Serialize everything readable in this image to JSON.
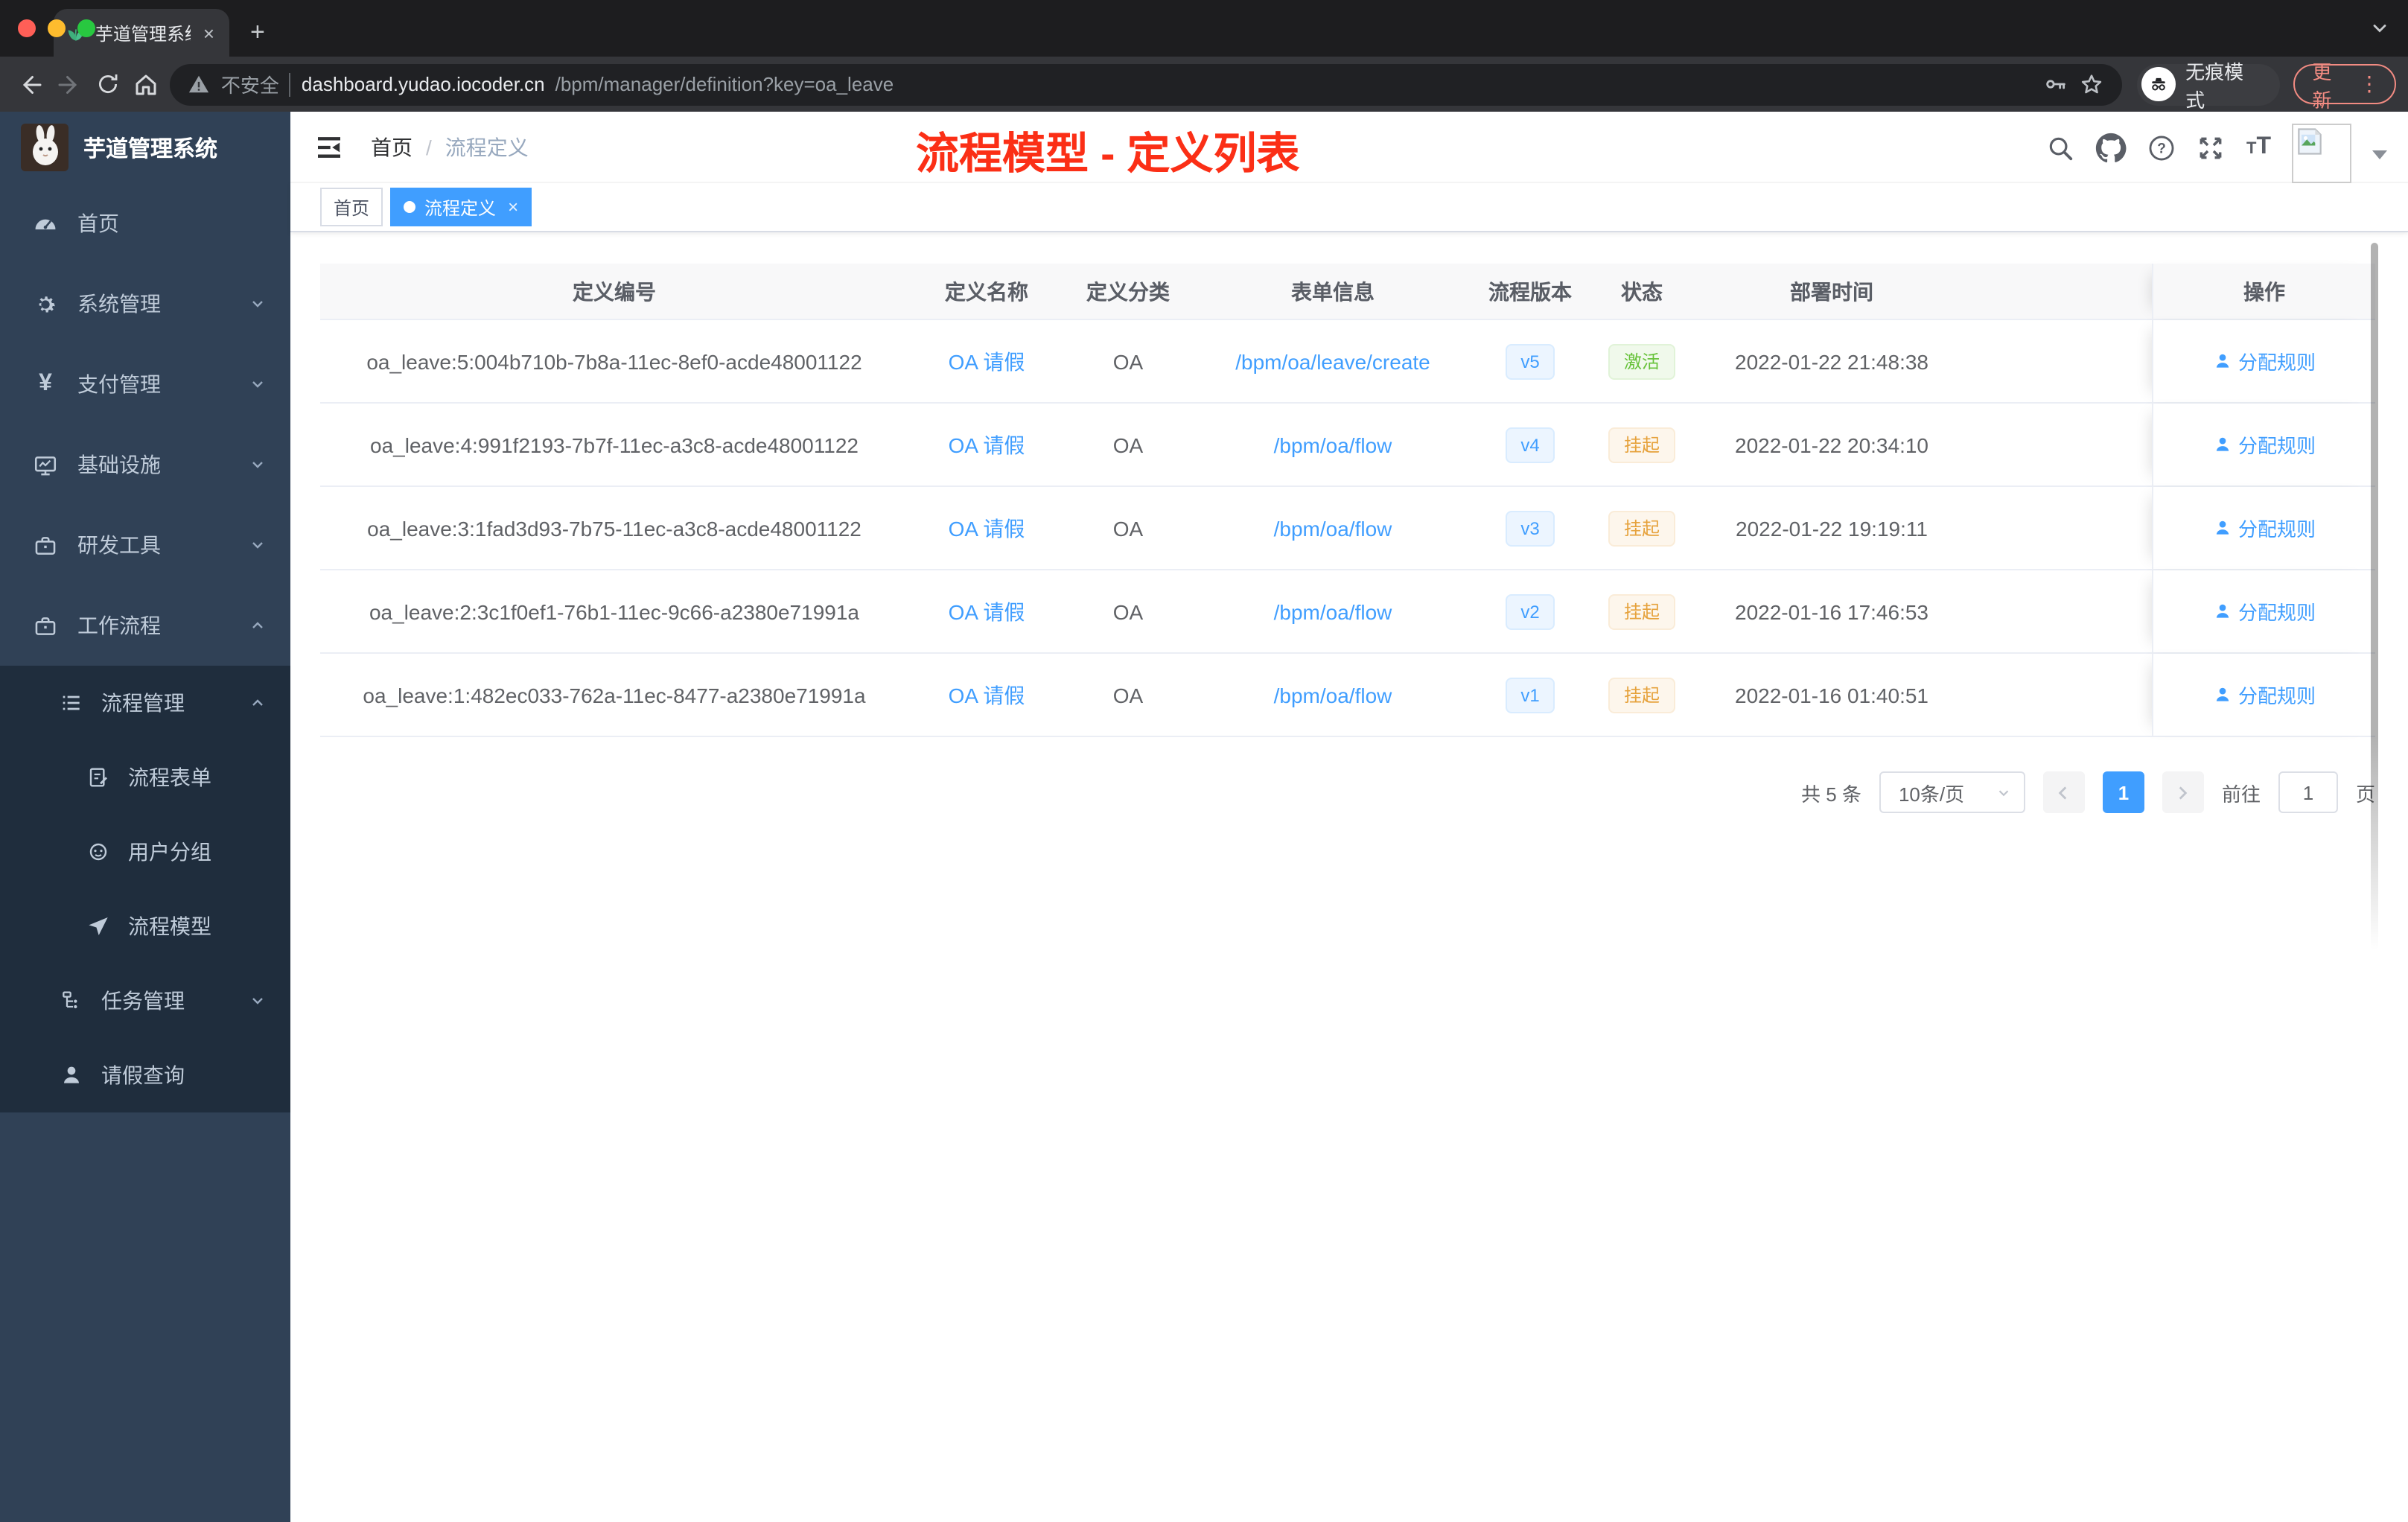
{
  "browser": {
    "tab_title": "芋道管理系统",
    "security_label": "不安全",
    "url_host": "dashboard.yudao.iocoder.cn",
    "url_path": "/bpm/manager/definition?key=oa_leave",
    "incognito_label": "无痕模式",
    "update_label": "更新",
    "glyphs": {
      "close_tab": "×",
      "new_tab": "+",
      "more": "⋮"
    }
  },
  "sidebar": {
    "logo_title": "芋道管理系统",
    "items": [
      {
        "icon": "dashboard-icon",
        "label": "首页"
      },
      {
        "icon": "gear-icon",
        "label": "系统管理"
      },
      {
        "icon": "yen-icon",
        "label": "支付管理"
      },
      {
        "icon": "monitor-icon",
        "label": "基础设施"
      },
      {
        "icon": "toolbox-icon",
        "label": "研发工具"
      },
      {
        "icon": "briefcase-icon",
        "label": "工作流程"
      }
    ],
    "yen_glyph": "¥",
    "submenu": [
      {
        "icon": "list-icon",
        "label": "流程管理"
      },
      {
        "icon": "form-icon",
        "label": "流程表单"
      },
      {
        "icon": "robot-icon",
        "label": "用户分组"
      },
      {
        "icon": "send-icon",
        "label": "流程模型"
      },
      {
        "icon": "tree-icon",
        "label": "任务管理"
      },
      {
        "icon": "person-icon",
        "label": "请假查询"
      }
    ]
  },
  "navbar": {
    "breadcrumb": {
      "home": "首页",
      "separator": "/",
      "current": "流程定义"
    },
    "annotation": "流程模型 - 定义列表",
    "help_glyph": "?",
    "font_size_glyph": "T"
  },
  "tags": {
    "home": "首页",
    "active": "流程定义",
    "close_glyph": "×"
  },
  "table": {
    "headers": [
      "定义编号",
      "定义名称",
      "定义分类",
      "表单信息",
      "流程版本",
      "状态",
      "部署时间",
      "操作"
    ],
    "action_label": "分配规则",
    "rows": [
      {
        "id": "oa_leave:5:004b710b-7b8a-11ec-8ef0-acde48001122",
        "name": "OA 请假",
        "category": "OA",
        "form": "/bpm/oa/leave/create",
        "version": "v5",
        "status": "激活",
        "time": "2022-01-22 21:48:38"
      },
      {
        "id": "oa_leave:4:991f2193-7b7f-11ec-a3c8-acde48001122",
        "name": "OA 请假",
        "category": "OA",
        "form": "/bpm/oa/flow",
        "version": "v4",
        "status": "挂起",
        "time": "2022-01-22 20:34:10"
      },
      {
        "id": "oa_leave:3:1fad3d93-7b75-11ec-a3c8-acde48001122",
        "name": "OA 请假",
        "category": "OA",
        "form": "/bpm/oa/flow",
        "version": "v3",
        "status": "挂起",
        "time": "2022-01-22 19:19:11"
      },
      {
        "id": "oa_leave:2:3c1f0ef1-76b1-11ec-9c66-a2380e71991a",
        "name": "OA 请假",
        "category": "OA",
        "form": "/bpm/oa/flow",
        "version": "v2",
        "status": "挂起",
        "time": "2022-01-16 17:46:53"
      },
      {
        "id": "oa_leave:1:482ec033-762a-11ec-8477-a2380e71991a",
        "name": "OA 请假",
        "category": "OA",
        "form": "/bpm/oa/flow",
        "version": "v1",
        "status": "挂起",
        "time": "2022-01-16 01:40:51"
      }
    ]
  },
  "pagination": {
    "total": "共 5 条",
    "page_size": "10条/页",
    "current_page": "1",
    "goto_label": "前往",
    "goto_value": "1",
    "page_unit": "页"
  },
  "colors": {
    "accent": "#409eff",
    "success": "#67c23a",
    "warning": "#e6a23c",
    "annotation_red": "#fb2f16",
    "sidebar_bg": "#304156",
    "submenu_bg": "#1f2d3d"
  }
}
